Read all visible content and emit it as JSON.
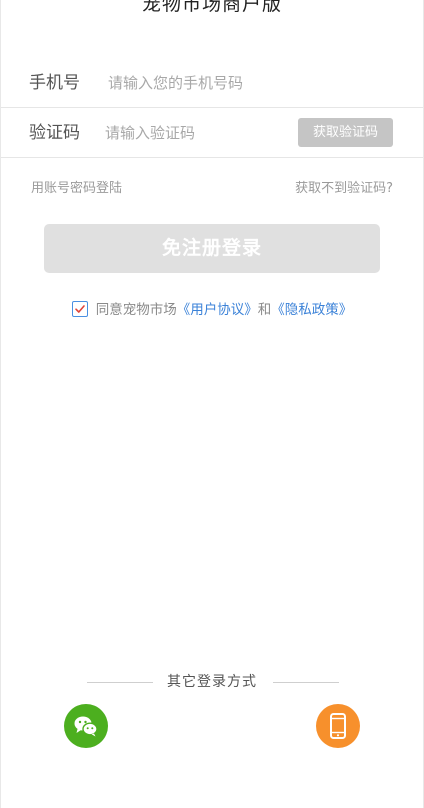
{
  "header": {
    "title": "宠物市场商户版"
  },
  "form": {
    "phone_label": "手机号",
    "phone_placeholder": "请输入您的手机号码",
    "phone_value": "",
    "code_label": "验证码",
    "code_placeholder": "请输入验证码",
    "code_value": "",
    "get_code_label": "获取验证码"
  },
  "links": {
    "password_login": "用账号密码登陆",
    "no_code": "获取不到验证码?"
  },
  "login_button": {
    "label": "免注册登录"
  },
  "agreement": {
    "checked": true,
    "prefix": "同意宠物市场",
    "user_agreement": "《用户协议》",
    "conjunction": "和",
    "privacy_policy": "《隐私政策》"
  },
  "other_login": {
    "label": "其它登录方式",
    "options": [
      {
        "icon": "wechat-icon",
        "color": "#4caf1f"
      },
      {
        "icon": "phone-icon",
        "color": "#f7902c"
      }
    ]
  },
  "colors": {
    "accent_link": "#3b82d8",
    "button_disabled": "#e0e0e0",
    "get_code_bg": "#c5c5c5"
  }
}
